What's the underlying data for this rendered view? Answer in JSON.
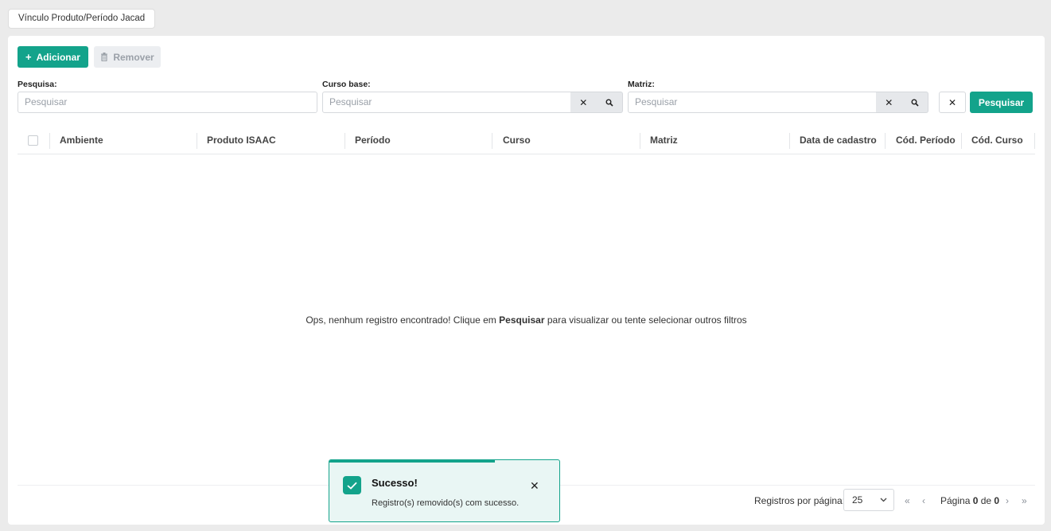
{
  "tab": {
    "label": "Vínculo Produto/Período Jacad"
  },
  "toolbar": {
    "add_label": "Adicionar",
    "remove_label": "Remover"
  },
  "filters": {
    "search": {
      "label": "Pesquisa:",
      "placeholder": "Pesquisar"
    },
    "curso_base": {
      "label": "Curso base:",
      "placeholder": "Pesquisar"
    },
    "matriz": {
      "label": "Matriz:",
      "placeholder": "Pesquisar"
    },
    "search_button": "Pesquisar"
  },
  "table": {
    "columns": [
      "Ambiente",
      "Produto ISAAC",
      "Período",
      "Curso",
      "Matriz",
      "Data de cadastro",
      "Cód. Período",
      "Cód. Curso"
    ],
    "empty_prefix": "Ops, nenhum registro encontrado! Clique em ",
    "empty_strong": "Pesquisar",
    "empty_suffix": " para visualizar ou tente selecionar outros filtros"
  },
  "pager": {
    "per_page_label": "Registros por página:",
    "per_page_value": "25",
    "page_prefix": "Página ",
    "current": "0",
    "of": " de ",
    "total": "0"
  },
  "toast": {
    "title": "Sucesso!",
    "message": "Registro(s) removido(s) com sucesso.",
    "progress": 0.72
  },
  "colors": {
    "accent": "#13a38b"
  }
}
